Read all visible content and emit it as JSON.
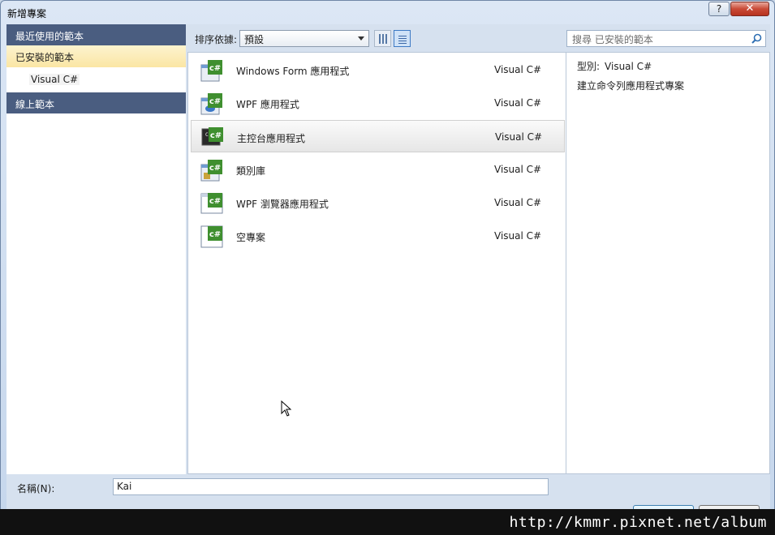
{
  "window": {
    "title": "新增專案",
    "help_label": "?",
    "close_label": "✕"
  },
  "left_panel": {
    "recent_header": "最近使用的範本",
    "installed": "已安裝的範本",
    "installed_child": "Visual C#",
    "online_header": "線上範本"
  },
  "toolbar": {
    "sort_label": "排序依據:",
    "sort_value": "預設",
    "search_placeholder": "搜尋 已安裝的範本"
  },
  "templates": [
    {
      "name": "Windows Form 應用程式",
      "lang": "Visual C#",
      "icon": "winforms-icon"
    },
    {
      "name": "WPF 應用程式",
      "lang": "Visual C#",
      "icon": "wpf-icon"
    },
    {
      "name": "主控台應用程式",
      "lang": "Visual C#",
      "icon": "console-icon"
    },
    {
      "name": "類別庫",
      "lang": "Visual C#",
      "icon": "class-library-icon"
    },
    {
      "name": "WPF 瀏覽器應用程式",
      "lang": "Visual C#",
      "icon": "wpf-browser-icon"
    },
    {
      "name": "空專案",
      "lang": "Visual C#",
      "icon": "empty-project-icon"
    }
  ],
  "selected_template_index": 2,
  "info": {
    "type_label": "型別:",
    "type_value": "Visual C#",
    "description": "建立命令列應用程式專案"
  },
  "name_field": {
    "label": "名稱(N):",
    "value": "Kai"
  },
  "watermark": "http://kmmr.pixnet.net/album"
}
